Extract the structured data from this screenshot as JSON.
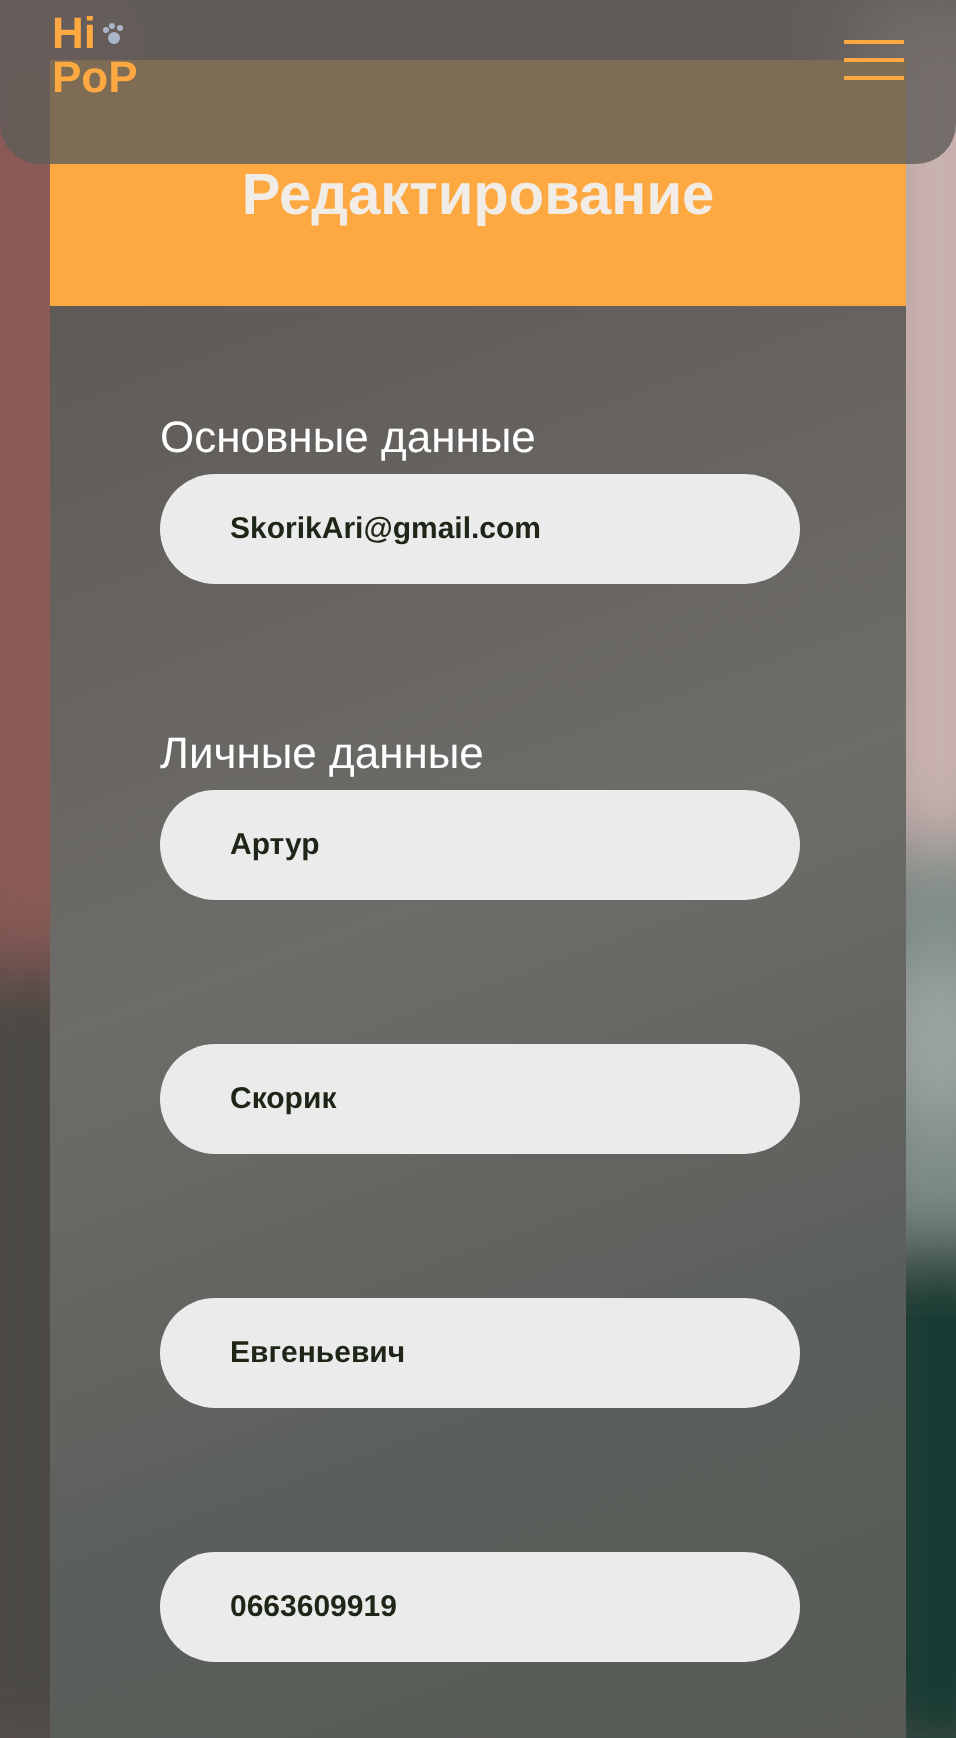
{
  "logo": {
    "line_1": "Hi",
    "line_2": "PoP"
  },
  "card": {
    "title": "Редактирование"
  },
  "sections": [
    {
      "heading": "Основные данные",
      "fields": [
        {
          "value": "SkorikAri@gmail.com"
        }
      ]
    },
    {
      "heading": "Личные данные",
      "fields": [
        {
          "value": "Артур"
        },
        {
          "value": "Скорик"
        },
        {
          "value": "Евгеньевич"
        },
        {
          "value": "0663609919"
        }
      ]
    }
  ]
}
